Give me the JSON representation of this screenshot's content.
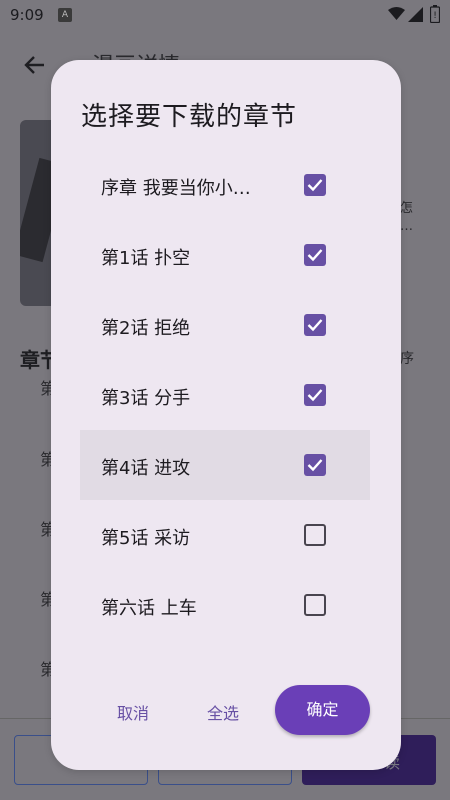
{
  "status_bar": {
    "time": "9:09",
    "notif_icon_letter": "A"
  },
  "background_page": {
    "title": "漫画详情",
    "desc_line1": "怎",
    "desc_line2": "…",
    "section_title": "章节",
    "order_label": "序",
    "row_char": "第",
    "footer_btn_label": "读"
  },
  "dialog": {
    "title": "选择要下载的章节",
    "chapters": [
      {
        "label": "序章 我要当你小…",
        "checked": true
      },
      {
        "label": "第1话 扑空",
        "checked": true
      },
      {
        "label": "第2话 拒绝",
        "checked": true
      },
      {
        "label": "第3话 分手",
        "checked": true
      },
      {
        "label": "第4话 进攻",
        "checked": true
      },
      {
        "label": "第5话 采访",
        "checked": false
      },
      {
        "label": "第六话 上车",
        "checked": false
      }
    ],
    "cancel_label": "取消",
    "select_all_label": "全选",
    "confirm_label": "确定"
  },
  "colors": {
    "primary": "#6750a4",
    "confirm_button": "#6a3fb7",
    "dialog_surface": "#eee7f1",
    "scrim_background": "#7a787e"
  }
}
